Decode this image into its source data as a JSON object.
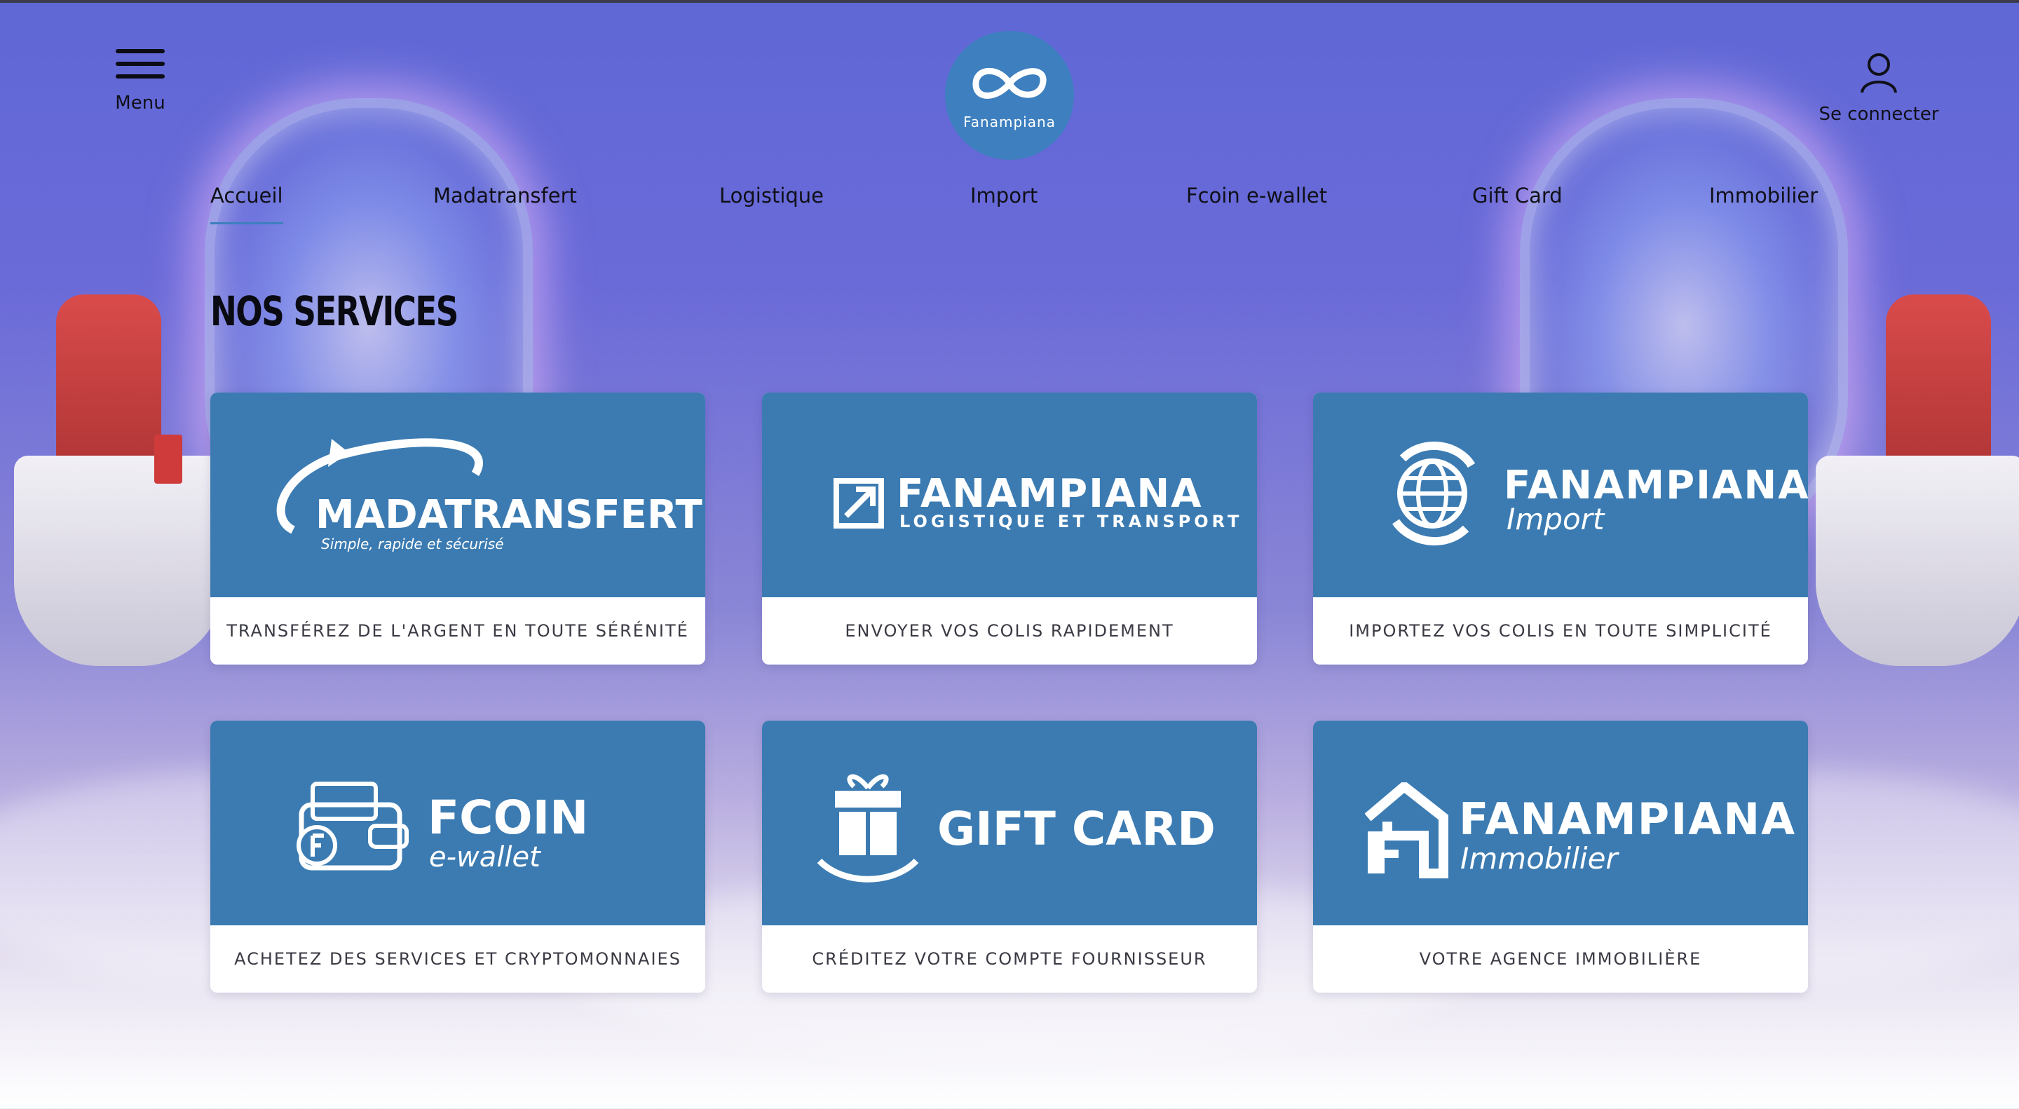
{
  "header": {
    "menu_label": "Menu",
    "logo_text": "Fanampiana",
    "login_label": "Se connecter"
  },
  "nav": {
    "items": [
      {
        "label": "Accueil",
        "active": true
      },
      {
        "label": "Madatransfert",
        "active": false
      },
      {
        "label": "Logistique",
        "active": false
      },
      {
        "label": "Import",
        "active": false
      },
      {
        "label": "Fcoin e-wallet",
        "active": false
      },
      {
        "label": "Gift Card",
        "active": false
      },
      {
        "label": "Immobilier",
        "active": false
      }
    ]
  },
  "section": {
    "title": "NOS SERVICES"
  },
  "services": [
    {
      "brand": "MADATRANSFERT",
      "sub": "Simple, rapide et sécurisé",
      "caption": "TRANSFÉREZ DE L'ARGENT EN TOUTE SÉRÉNITÉ",
      "icon": "swoosh-icon"
    },
    {
      "brand": "FANAMPIANA",
      "sub": "LOGISTIQUE ET TRANSPORT",
      "caption": "ENVOYER VOS COLIS RAPIDEMENT",
      "icon": "arrow-box-icon"
    },
    {
      "brand": "FANAMPIANA",
      "sub": "Import",
      "caption": "IMPORTEZ VOS COLIS EN TOUTE SIMPLICITÉ",
      "icon": "globe-icon"
    },
    {
      "brand": "FCOIN",
      "sub": "e-wallet",
      "caption": "ACHETEZ DES SERVICES ET CRYPTOMONNAIES",
      "icon": "wallet-icon"
    },
    {
      "brand": "GIFT CARD",
      "sub": "",
      "caption": "CRÉDITEZ VOTRE COMPTE FOURNISSEUR",
      "icon": "gift-icon"
    },
    {
      "brand": "FANAMPIANA",
      "sub": "Immobilier",
      "caption": "VOTRE AGENCE IMMOBILIÈRE",
      "icon": "house-icon"
    }
  ],
  "colors": {
    "card_blue": "#3b7bb2",
    "logo_blue": "#3d7fbf",
    "accent": "#3d7fbf"
  }
}
